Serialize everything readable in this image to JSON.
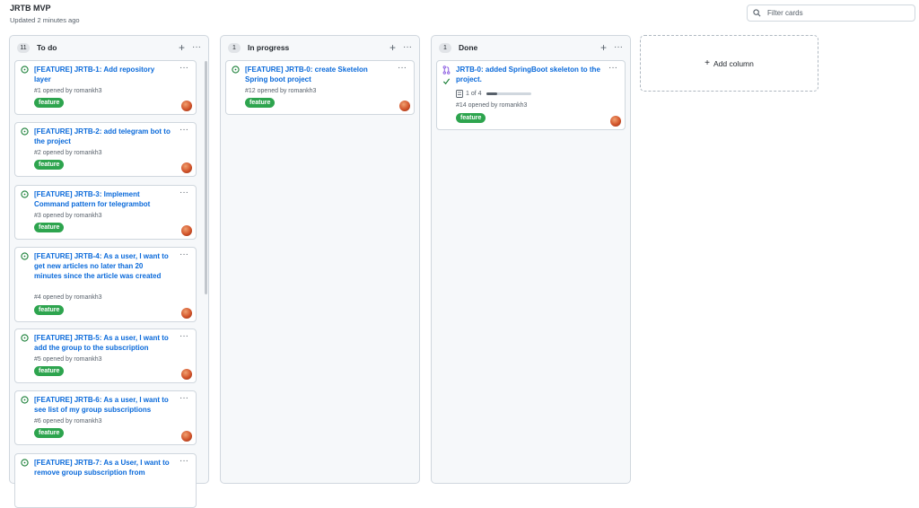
{
  "board": {
    "title": "JRTB MVP",
    "updated": "Updated 2 minutes ago"
  },
  "filter": {
    "placeholder": "Filter cards"
  },
  "add_column": {
    "label": "Add column"
  },
  "columns": [
    {
      "title": "To do",
      "count": "11",
      "cards": [
        {
          "title": "[FEATURE] JRTB-1: Add repository layer",
          "number": "#1",
          "opened": "opened by",
          "author": "romankh3",
          "label": "feature"
        },
        {
          "title": "[FEATURE] JRTB-2: add telegram bot to the project",
          "number": "#2",
          "opened": "opened by",
          "author": "romankh3",
          "label": "feature"
        },
        {
          "title": "[FEATURE] JRTB-3: Implement Command pattern for telegrambot",
          "number": "#3",
          "opened": "opened by",
          "author": "romankh3",
          "label": "feature"
        },
        {
          "title": "[FEATURE] JRTB-4: As a user, I want to get new articles no later than 20 minutes since the article was created",
          "number": "#4",
          "opened": "opened by",
          "author": "romankh3",
          "label": "feature"
        },
        {
          "title": "[FEATURE] JRTB-5: As a user, I want to add the group to the subscription",
          "number": "#5",
          "opened": "opened by",
          "author": "romankh3",
          "label": "feature"
        },
        {
          "title": "[FEATURE] JRTB-6: As a user, I want to see list of my group subscriptions",
          "number": "#6",
          "opened": "opened by",
          "author": "romankh3",
          "label": "feature"
        },
        {
          "title": "[FEATURE] JRTB-7: As a User, I want to remove group subscription from",
          "number": "",
          "opened": "",
          "author": "",
          "label": ""
        }
      ]
    },
    {
      "title": "In progress",
      "count": "1",
      "cards": [
        {
          "title": "[FEATURE] JRTB-0: create Sketelon Spring boot project",
          "number": "#12",
          "opened": "opened by",
          "author": "romankh3",
          "label": "feature"
        }
      ]
    },
    {
      "title": "Done",
      "count": "1",
      "cards": [
        {
          "title": "JRTB-0: added SpringBoot skeleton to the project.",
          "number": "#14",
          "opened": "opened by",
          "author": "romankh3",
          "label": "feature",
          "tasks": "1 of 4",
          "progress": 0.25
        }
      ]
    }
  ],
  "colors": {
    "link": "#0969da",
    "label_bg": "#2da44e",
    "open_icon": "#1a7f37",
    "pr_icon": "#8250df"
  },
  "icons": {
    "open": "issue-opened-icon",
    "pr": "pull-request-icon",
    "search": "search-icon",
    "menu": "kebab-icon"
  }
}
